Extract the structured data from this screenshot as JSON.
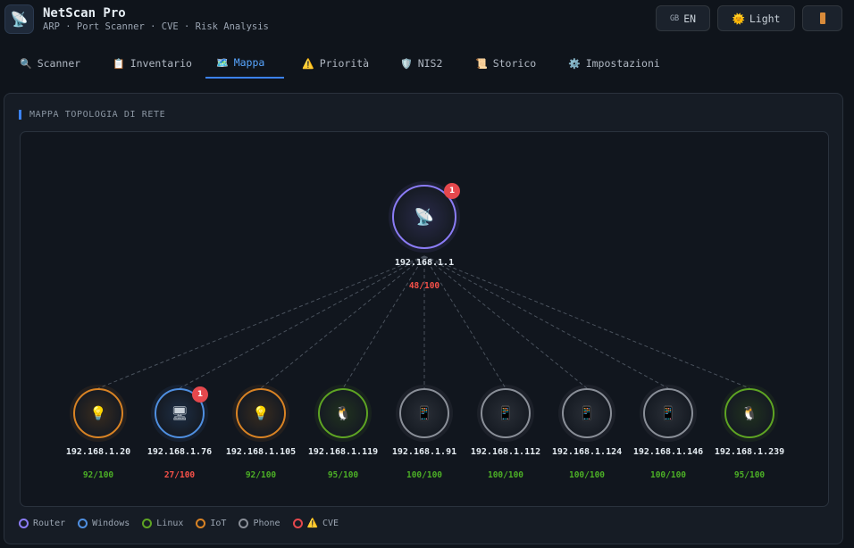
{
  "app": {
    "title": "NetScan Pro",
    "subtitle": "ARP · Port Scanner · CVE · Risk Analysis",
    "logo_icon": "📡"
  },
  "header_buttons": {
    "lang_flag": "GB",
    "lang_label": "EN",
    "theme_icon": "🌞",
    "theme_label": "Light",
    "exit_icon": "door-icon"
  },
  "tabs": [
    {
      "icon": "🔍",
      "label": "Scanner"
    },
    {
      "icon": "📋",
      "label": "Inventario"
    },
    {
      "icon": "🗺️",
      "label": "Mappa",
      "active": true
    },
    {
      "icon": "⚠️",
      "label": "Priorità"
    },
    {
      "icon": "🛡️",
      "label": "NIS2"
    },
    {
      "icon": "📜",
      "label": "Storico"
    },
    {
      "icon": "⚙️",
      "label": "Impostazioni"
    }
  ],
  "section_title": "MAPPA TOPOLOGIA DI RETE",
  "router": {
    "ip": "192.168.1.1",
    "score": "48/100",
    "type": "Router",
    "icon": "📡",
    "cve_count": "1",
    "color": "#8b7cf6",
    "score_color": "#f85149"
  },
  "devices": [
    {
      "ip": "192.168.1.20",
      "score": "92/100",
      "type": "IoT",
      "icon": "💡",
      "color": "#d98324",
      "score_color": "#4caf26"
    },
    {
      "ip": "192.168.1.76",
      "score": "27/100",
      "type": "Windows",
      "icon": "🖥",
      "color": "#4f8fe0",
      "score_color": "#f85149",
      "cve_count": "1"
    },
    {
      "ip": "192.168.1.105",
      "score": "92/100",
      "type": "IoT",
      "icon": "💡",
      "color": "#d98324",
      "score_color": "#4caf26"
    },
    {
      "ip": "192.168.1.119",
      "score": "95/100",
      "type": "Linux",
      "icon": "🐧",
      "color": "#5ea423",
      "score_color": "#4caf26"
    },
    {
      "ip": "192.168.1.91",
      "score": "100/100",
      "type": "Phone",
      "icon": "📱",
      "color": "#8a8f98",
      "score_color": "#4caf26"
    },
    {
      "ip": "192.168.1.112",
      "score": "100/100",
      "type": "Phone",
      "icon": "📱",
      "color": "#8a8f98",
      "score_color": "#4caf26"
    },
    {
      "ip": "192.168.1.124",
      "score": "100/100",
      "type": "Phone",
      "icon": "📱",
      "color": "#8a8f98",
      "score_color": "#4caf26"
    },
    {
      "ip": "192.168.1.146",
      "score": "100/100",
      "type": "Phone",
      "icon": "📱",
      "color": "#8a8f98",
      "score_color": "#4caf26"
    },
    {
      "ip": "192.168.1.239",
      "score": "95/100",
      "type": "Linux",
      "icon": "🐧",
      "color": "#5ea423",
      "score_color": "#4caf26"
    }
  ],
  "legend": [
    {
      "label": "Router",
      "color": "#8b7cf6"
    },
    {
      "label": "Windows",
      "color": "#4f8fe0"
    },
    {
      "label": "Linux",
      "color": "#5ea423"
    },
    {
      "label": "IoT",
      "color": "#d98324"
    },
    {
      "label": "Phone",
      "color": "#8a8f98"
    },
    {
      "label": "CVE",
      "color": "#e5484d",
      "icon": "⚠️"
    }
  ]
}
